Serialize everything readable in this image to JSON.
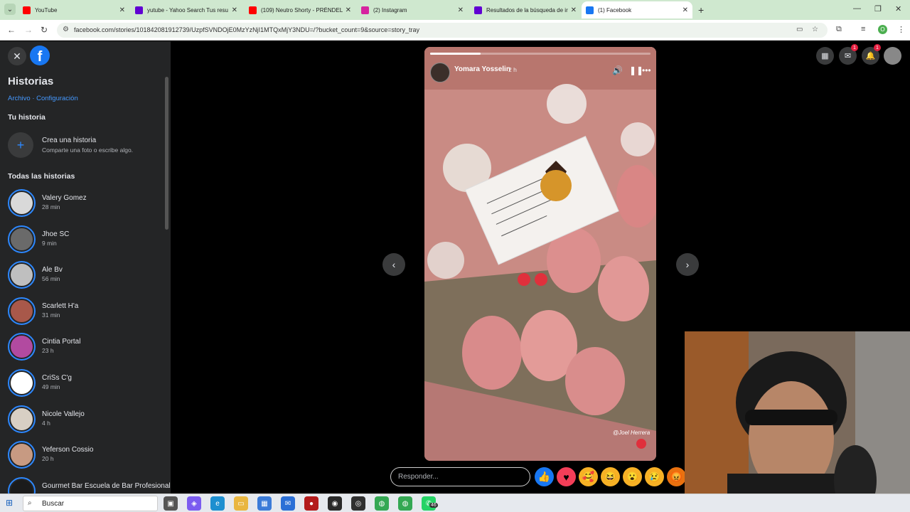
{
  "browser": {
    "tabs": [
      {
        "title": "YouTube",
        "favicon": "youtube-icon",
        "color": "#ff0000",
        "active": false
      },
      {
        "title": "yutube - Yahoo Search Tus resu",
        "favicon": "yahoo-icon",
        "color": "#6001d2",
        "active": false
      },
      {
        "title": "(109) Neutro Shorty - PRÉNDEL",
        "favicon": "youtube-icon",
        "color": "#ff0000",
        "active": false
      },
      {
        "title": "(2) Instagram",
        "favicon": "instagram-icon",
        "color": "#d6249f",
        "active": false
      },
      {
        "title": "Resultados de la búsqueda de ir",
        "favicon": "yahoo-icon",
        "color": "#6001d2",
        "active": false
      },
      {
        "title": "(1) Facebook",
        "favicon": "facebook-icon",
        "color": "#1877f2",
        "active": true
      }
    ],
    "url": "facebook.com/stories/101842081912739/UzpfSVNDOjE0MzYzNjI1MTQxMjY3NDU=/?bucket_count=9&source=story_tray",
    "profile_initial": "O"
  },
  "sidebar": {
    "title": "Historias",
    "links": "Archivo · Configuración",
    "your_story_heading": "Tu historia",
    "create": {
      "title": "Crea una historia",
      "subtitle": "Comparte una foto o escribe algo."
    },
    "all_stories_heading": "Todas las historias",
    "stories": [
      {
        "name": "Valery Gomez",
        "time": "28 min",
        "color": "#d9d9d9"
      },
      {
        "name": "Jhoe SC",
        "time": "9 min",
        "color": "#6a6a6a"
      },
      {
        "name": "Ale Bv",
        "time": "56 min",
        "color": "#bfbfbf"
      },
      {
        "name": "Scarlett H'a",
        "time": "31 min",
        "color": "#a8584a"
      },
      {
        "name": "Cintia Portal",
        "time": "23 h",
        "color": "#b24aa0"
      },
      {
        "name": "CriSs C'g",
        "time": "49 min",
        "color": "#ffffff"
      },
      {
        "name": "Nicole Vallejo",
        "time": "4 h",
        "color": "#d8cfc4"
      },
      {
        "name": "Yeferson Cossio",
        "time": "20 h",
        "color": "#c79a82"
      },
      {
        "name": "Gourmet Bar Escuela de Bar Profesional",
        "time": "",
        "color": "#1b1b1b"
      }
    ]
  },
  "story": {
    "author": "Yomara Yosselin",
    "time": "2 h",
    "progress": 0.23,
    "watermark": "@Joel Herrera"
  },
  "reply": {
    "placeholder": "Responder..."
  },
  "reactions": [
    {
      "name": "like",
      "glyph": "👍",
      "color": "#1877f2"
    },
    {
      "name": "love",
      "glyph": "♥",
      "color": "#f33e58"
    },
    {
      "name": "care",
      "glyph": "🥰",
      "color": "#f7b125"
    },
    {
      "name": "haha",
      "glyph": "😆",
      "color": "#f7b125"
    },
    {
      "name": "wow",
      "glyph": "😮",
      "color": "#f7b125"
    },
    {
      "name": "sad",
      "glyph": "😢",
      "color": "#f7b125"
    },
    {
      "name": "angry",
      "glyph": "😡",
      "color": "#e9710f"
    }
  ],
  "top_icons": {
    "messenger_badge": "1",
    "notifications_badge": "1"
  },
  "taskbar": {
    "search_label": "Buscar",
    "whatsapp_badge": "46"
  }
}
